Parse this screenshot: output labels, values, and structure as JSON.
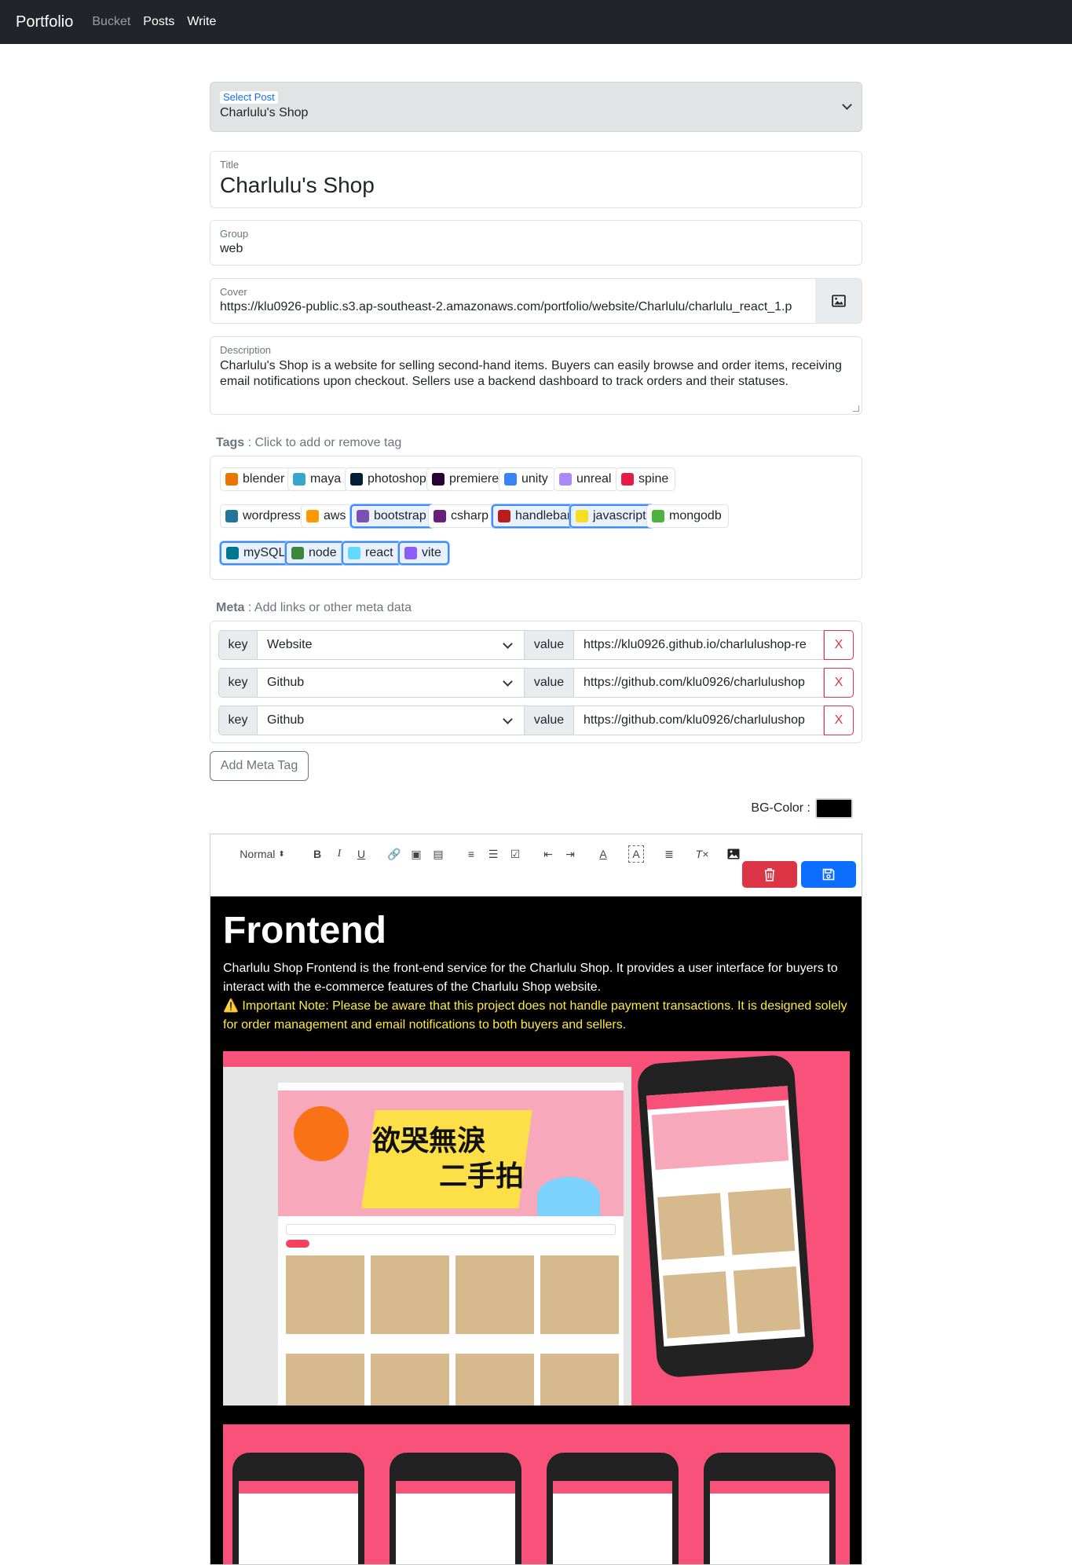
{
  "nav": {
    "brand": "Portfolio",
    "links": [
      "Bucket",
      "Posts",
      "Write"
    ]
  },
  "select_post": {
    "label": "Select Post",
    "value": "Charlulu's Shop"
  },
  "title": {
    "label": "Title",
    "value": "Charlulu's Shop"
  },
  "group": {
    "label": "Group",
    "value": "web"
  },
  "cover": {
    "label": "Cover",
    "value": "https://klu0926-public.s3.ap-southeast-2.amazonaws.com/portfolio/website/Charlulu/charlulu_react_1.p"
  },
  "description": {
    "label": "Description",
    "value": "Charlulu's Shop is a website for selling second-hand items. Buyers can easily browse and order items, receiving email notifications upon checkout. Sellers use a backend dashboard to track orders and their statuses."
  },
  "tags_header": {
    "label": "Tags",
    "hint": " : Click to add or remove tag"
  },
  "tags": [
    {
      "name": "blender",
      "selected": false,
      "icon": "blender-icon",
      "color": "#ea7600"
    },
    {
      "name": "maya",
      "selected": false,
      "icon": "maya-icon",
      "color": "#37a5cc"
    },
    {
      "name": "photoshop",
      "selected": false,
      "icon": "photoshop-icon",
      "color": "#001e36"
    },
    {
      "name": "premiere",
      "selected": false,
      "icon": "premiere-icon",
      "color": "#2a0034"
    },
    {
      "name": "unity",
      "selected": false,
      "icon": "unity-icon",
      "color": "#3b82f6"
    },
    {
      "name": "unreal",
      "selected": false,
      "icon": "unreal-icon",
      "color": "#a78bfa"
    },
    {
      "name": "spine",
      "selected": false,
      "icon": "spine-icon",
      "color": "#e11d48"
    },
    {
      "name": "wordpress",
      "selected": false,
      "icon": "wordpress-icon",
      "color": "#21759b"
    },
    {
      "name": "aws",
      "selected": false,
      "icon": "aws-icon",
      "color": "#ff9900"
    },
    {
      "name": "bootstrap",
      "selected": true,
      "icon": "bootstrap-icon",
      "color": "#7952b3"
    },
    {
      "name": "csharp",
      "selected": false,
      "icon": "csharp-icon",
      "color": "#68217a"
    },
    {
      "name": "handlebar",
      "selected": true,
      "icon": "handlebar-icon",
      "color": "#b91c1c"
    },
    {
      "name": "javascript",
      "selected": true,
      "icon": "javascript-icon",
      "color": "#f7df1e"
    },
    {
      "name": "mongodb",
      "selected": false,
      "icon": "mongodb-icon",
      "color": "#4db33d"
    },
    {
      "name": "mySQL",
      "selected": true,
      "icon": "mysql-icon",
      "color": "#00758f"
    },
    {
      "name": "node",
      "selected": true,
      "icon": "node-icon",
      "color": "#3c873a"
    },
    {
      "name": "react",
      "selected": true,
      "icon": "react-icon",
      "color": "#61dafb"
    },
    {
      "name": "vite",
      "selected": true,
      "icon": "vite-icon",
      "color": "#8b5cf6"
    }
  ],
  "meta_header": {
    "label": "Meta",
    "hint": " : Add links or other meta data"
  },
  "meta_rows": [
    {
      "key_label": "key",
      "key": "Website",
      "value_label": "value",
      "value": "https://klu0926.github.io/charlulushop-re",
      "remove": "X"
    },
    {
      "key_label": "key",
      "key": "Github",
      "value_label": "value",
      "value": "https://github.com/klu0926/charlulushop",
      "remove": "X"
    },
    {
      "key_label": "key",
      "key": "Github",
      "value_label": "value",
      "value": "https://github.com/klu0926/charlulushop",
      "remove": "X"
    }
  ],
  "add_meta": "Add Meta Tag",
  "bg_color": {
    "label": "BG-Color :",
    "value": "#000000"
  },
  "toolbar": {
    "format": "Normal"
  },
  "content": {
    "heading": "Frontend",
    "p1": "Charlulu Shop Frontend is the front-end service for the Charlulu Shop. It provides a user interface for buyers to interact with the e-commerce features of the Charlulu Shop website.",
    "p2": "⚠️ Important Note: Please be aware that this project does not handle payment transactions. It is designed solely for order management and email notifications to both buyers and sellers.",
    "banner_text_1": "欲哭無淚",
    "banner_text_2": "二手拍"
  },
  "colors": {
    "navbar": "#212529",
    "primary": "#0d6efd",
    "danger": "#dc3545",
    "brand_pink": "#f8527a"
  }
}
